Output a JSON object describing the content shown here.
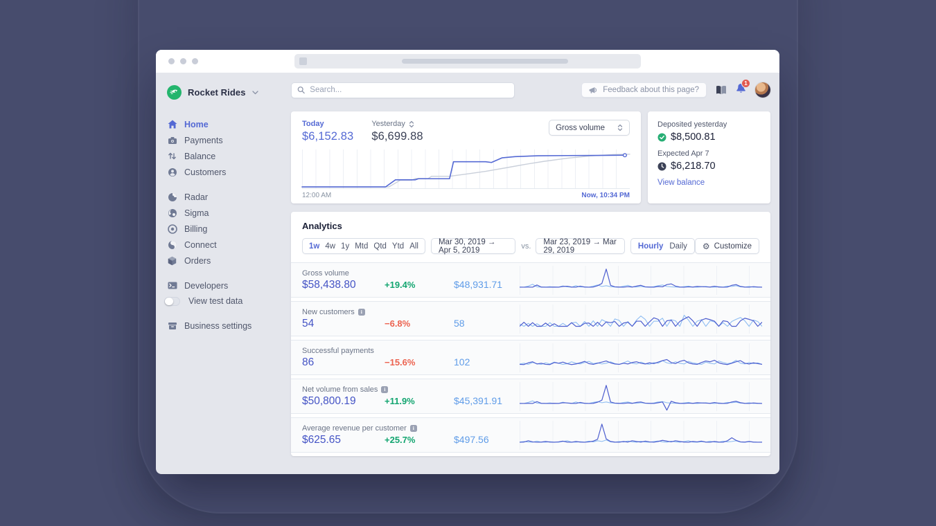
{
  "browser": {
    "traffic_lights": [
      "close",
      "minimize",
      "zoom"
    ]
  },
  "sidebar": {
    "account": {
      "name": "Rocket Rides",
      "logo_color": "#23b56d"
    },
    "items": [
      {
        "label": "Home",
        "icon": "home-icon",
        "active": true
      },
      {
        "label": "Payments",
        "icon": "payments-icon",
        "active": false
      },
      {
        "label": "Balance",
        "icon": "balance-icon",
        "active": false
      },
      {
        "label": "Customers",
        "icon": "customers-icon",
        "active": false
      },
      {
        "label": "Radar",
        "icon": "radar-icon",
        "active": false
      },
      {
        "label": "Sigma",
        "icon": "sigma-icon",
        "active": false
      },
      {
        "label": "Billing",
        "icon": "billing-icon",
        "active": false
      },
      {
        "label": "Connect",
        "icon": "connect-icon",
        "active": false
      },
      {
        "label": "Orders",
        "icon": "orders-icon",
        "active": false
      },
      {
        "label": "Developers",
        "icon": "developers-icon",
        "active": false
      },
      {
        "label": "View test data",
        "icon": "toggle-off",
        "active": false
      },
      {
        "label": "Business settings",
        "icon": "business-settings-icon",
        "active": false
      }
    ]
  },
  "topbar": {
    "search_placeholder": "Search...",
    "feedback_label": "Feedback about this page?",
    "notification_count": "1"
  },
  "overview": {
    "today": {
      "label": "Today",
      "value": "$6,152.83"
    },
    "yesterday": {
      "label": "Yesterday",
      "value": "$6,699.88"
    },
    "metric_select": "Gross volume",
    "x_start": "12:00 AM",
    "x_end": "Now, 10:34 PM",
    "chart": {
      "type": "line",
      "today_points": [
        [
          0,
          0.02
        ],
        [
          0.255,
          0.02
        ],
        [
          0.285,
          0.22
        ],
        [
          0.345,
          0.22
        ],
        [
          0.355,
          0.25
        ],
        [
          0.45,
          0.25
        ],
        [
          0.462,
          0.73
        ],
        [
          0.56,
          0.73
        ],
        [
          0.578,
          0.71
        ],
        [
          0.61,
          0.84
        ],
        [
          0.65,
          0.875
        ],
        [
          0.72,
          0.9
        ],
        [
          0.81,
          0.905
        ],
        [
          0.9,
          0.91
        ],
        [
          0.985,
          0.915
        ]
      ],
      "yesterday_points": [
        [
          0,
          0.02
        ],
        [
          0.265,
          0.02
        ],
        [
          0.3,
          0.21
        ],
        [
          0.335,
          0.21
        ],
        [
          0.345,
          0.255
        ],
        [
          0.385,
          0.255
        ],
        [
          0.395,
          0.32
        ],
        [
          0.45,
          0.32
        ],
        [
          0.5,
          0.38
        ],
        [
          0.56,
          0.46
        ],
        [
          0.62,
          0.555
        ],
        [
          0.68,
          0.655
        ],
        [
          0.74,
          0.745
        ],
        [
          0.81,
          0.83
        ],
        [
          0.88,
          0.895
        ],
        [
          0.95,
          0.935
        ],
        [
          1,
          0.945
        ]
      ]
    }
  },
  "deposits": {
    "deposited_label": "Deposited yesterday",
    "deposited_value": "$8,500.81",
    "expected_label": "Expected Apr 7",
    "expected_value": "$6,218.70",
    "link_label": "View balance",
    "check_color": "#27ae74",
    "clock_color": "#3c4257"
  },
  "analytics": {
    "title": "Analytics",
    "range_options": [
      "1w",
      "4w",
      "1y",
      "Mtd",
      "Qtd",
      "Ytd",
      "All"
    ],
    "active_range": "1w",
    "date_range_current": "Mar 30, 2019 →  Apr 5, 2019",
    "vs_label": "vs.",
    "date_range_previous": "Mar 23, 2019 → Mar 29, 2019",
    "granularity_options": [
      "Hourly",
      "Daily"
    ],
    "active_granularity": "Hourly",
    "customize_label": "Customize",
    "metrics": [
      {
        "label": "Gross volume",
        "value": "$58,438.80",
        "change": "+19.4%",
        "change_direction": "up",
        "comparison": "$48,931.71",
        "has_info": false,
        "spark_current": [
          2,
          2,
          3,
          2,
          14,
          3,
          2,
          2,
          3,
          2,
          6,
          7,
          3,
          2,
          8,
          3,
          2,
          3,
          10,
          22,
          100,
          12,
          4,
          3,
          2,
          5,
          3,
          8,
          12,
          4,
          3,
          2,
          6,
          4,
          16,
          20,
          8,
          3,
          2,
          4,
          3,
          6,
          5,
          4,
          3,
          7,
          3,
          2,
          3,
          12,
          16,
          6,
          3,
          2,
          5,
          3,
          2
        ],
        "spark_previous": [
          3,
          2,
          8,
          18,
          4,
          2,
          3,
          5,
          2,
          3,
          9,
          4,
          2,
          10,
          3,
          4,
          2,
          8,
          14,
          6,
          10,
          5,
          3,
          2,
          7,
          12,
          4,
          3,
          6,
          3,
          2,
          5,
          10,
          14,
          6,
          4,
          3,
          2,
          5,
          8,
          3,
          2,
          4,
          6,
          3,
          2,
          5,
          3,
          8,
          6,
          10,
          4,
          3,
          6,
          2,
          3,
          2
        ]
      },
      {
        "label": "New customers",
        "value": "54",
        "change": "−6.8%",
        "change_direction": "down",
        "comparison": "58",
        "has_info": true,
        "spark_current": [
          0,
          22,
          0,
          20,
          0,
          0,
          18,
          0,
          14,
          0,
          0,
          0,
          20,
          0,
          0,
          16,
          18,
          0,
          22,
          0,
          24,
          20,
          26,
          0,
          18,
          22,
          0,
          28,
          28,
          0,
          24,
          46,
          38,
          0,
          30,
          34,
          0,
          26,
          40,
          52,
          30,
          0,
          34,
          42,
          36,
          28,
          0,
          30,
          26,
          0,
          0,
          30,
          44,
          38,
          30,
          0,
          22
        ],
        "spark_previous": [
          12,
          0,
          16,
          0,
          14,
          0,
          0,
          20,
          0,
          0,
          16,
          0,
          18,
          22,
          0,
          26,
          0,
          30,
          0,
          36,
          24,
          0,
          40,
          32,
          0,
          26,
          0,
          34,
          56,
          38,
          0,
          28,
          28,
          44,
          0,
          36,
          30,
          0,
          60,
          34,
          0,
          28,
          36,
          0,
          30,
          24,
          0,
          20,
          0,
          26,
          38,
          48,
          30,
          0,
          34,
          26,
          0
        ]
      },
      {
        "label": "Successful payments",
        "value": "86",
        "change": "−15.6%",
        "change_direction": "down",
        "comparison": "102",
        "has_info": false,
        "spark_current": [
          4,
          3,
          12,
          18,
          6,
          10,
          4,
          3,
          14,
          10,
          16,
          8,
          3,
          6,
          12,
          20,
          8,
          4,
          10,
          16,
          22,
          12,
          6,
          4,
          10,
          6,
          14,
          18,
          10,
          6,
          12,
          8,
          16,
          24,
          30,
          14,
          8,
          20,
          26,
          12,
          6,
          4,
          14,
          22,
          18,
          26,
          12,
          6,
          3,
          10,
          18,
          24,
          10,
          6,
          12,
          8,
          4
        ],
        "spark_previous": [
          6,
          10,
          4,
          14,
          8,
          4,
          12,
          6,
          16,
          10,
          4,
          8,
          18,
          10,
          6,
          14,
          20,
          8,
          12,
          6,
          10,
          18,
          8,
          4,
          12,
          22,
          10,
          6,
          16,
          8,
          4,
          14,
          10,
          24,
          12,
          8,
          18,
          10,
          6,
          20,
          12,
          8,
          4,
          16,
          10,
          6,
          22,
          14,
          8,
          12,
          26,
          10,
          6,
          14,
          8,
          12,
          4
        ]
      },
      {
        "label": "Net volume from sales",
        "value": "$50,800.19",
        "change": "+11.9%",
        "change_direction": "up",
        "comparison": "$45,391.91",
        "has_info": true,
        "spark_current": [
          2,
          2,
          3,
          2,
          12,
          3,
          2,
          2,
          3,
          2,
          6,
          5,
          3,
          2,
          8,
          3,
          2,
          3,
          9,
          20,
          100,
          10,
          4,
          3,
          2,
          5,
          3,
          8,
          10,
          4,
          3,
          2,
          6,
          10,
          -34,
          14,
          6,
          3,
          2,
          4,
          3,
          6,
          5,
          4,
          3,
          7,
          3,
          2,
          3,
          10,
          14,
          6,
          3,
          2,
          5,
          3,
          2
        ],
        "spark_previous": [
          3,
          2,
          8,
          16,
          4,
          2,
          3,
          5,
          2,
          3,
          9,
          4,
          2,
          10,
          3,
          4,
          2,
          8,
          12,
          6,
          10,
          5,
          3,
          2,
          7,
          10,
          4,
          3,
          6,
          3,
          2,
          5,
          10,
          12,
          6,
          4,
          3,
          2,
          5,
          8,
          3,
          2,
          4,
          6,
          3,
          2,
          5,
          3,
          8,
          6,
          9,
          4,
          3,
          6,
          2,
          3,
          2
        ]
      },
      {
        "label": "Average revenue per customer",
        "value": "$625.65",
        "change": "+25.7%",
        "change_direction": "up",
        "comparison": "$497.56",
        "has_info": true,
        "spark_current": [
          2,
          3,
          10,
          4,
          2,
          3,
          6,
          3,
          2,
          4,
          8,
          3,
          2,
          6,
          3,
          2,
          4,
          8,
          18,
          100,
          20,
          6,
          3,
          2,
          6,
          3,
          10,
          6,
          3,
          8,
          4,
          2,
          6,
          12,
          8,
          4,
          10,
          6,
          3,
          2,
          6,
          4,
          8,
          3,
          2,
          6,
          3,
          2,
          10,
          26,
          12,
          4,
          3,
          6,
          3,
          2,
          2
        ],
        "spark_previous": [
          3,
          6,
          3,
          2,
          8,
          3,
          2,
          5,
          3,
          2,
          6,
          10,
          3,
          2,
          5,
          3,
          8,
          4,
          10,
          6,
          14,
          4,
          2,
          6,
          3,
          9,
          4,
          2,
          7,
          3,
          2,
          6,
          9,
          4,
          2,
          8,
          4,
          2,
          6,
          10,
          3,
          2,
          5,
          3,
          7,
          3,
          2,
          8,
          4,
          6,
          10,
          3,
          2,
          5,
          3,
          2,
          3
        ]
      }
    ]
  },
  "colors": {
    "accent_blue": "#5469d4",
    "value_indigo": "#4453c5",
    "comparison_blue": "#5f9ce8",
    "positive_green": "#13a570",
    "negative_red": "#ec6350",
    "spark_current": "#4d5ecf",
    "spark_previous": "#8fbdf2",
    "backdrop": "#474c6d"
  }
}
